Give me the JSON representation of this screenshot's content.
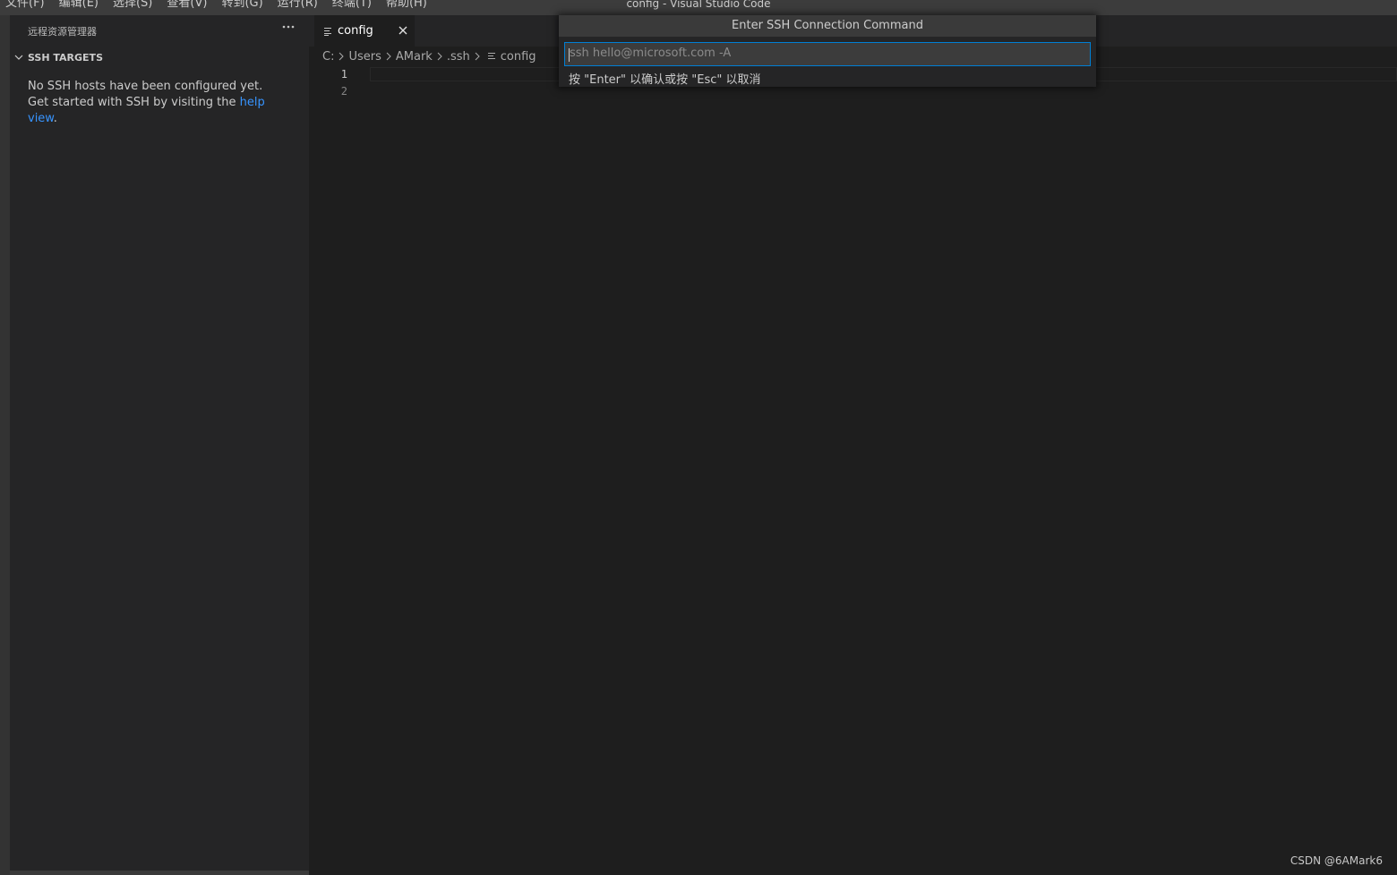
{
  "window": {
    "title": "config - Visual Studio Code"
  },
  "menu": [
    "文件(F)",
    "编辑(E)",
    "选择(S)",
    "查看(V)",
    "转到(G)",
    "运行(R)",
    "终端(T)",
    "帮助(H)"
  ],
  "sidebar": {
    "title": "远程资源管理器",
    "more_icon": "ellipsis-icon",
    "section": {
      "label": "SSH TARGETS",
      "icon": "chevron-down-icon"
    },
    "empty_message": {
      "text_before": "No SSH hosts have been configured yet. Get started with SSH by visiting the ",
      "link": "help view",
      "text_after": "."
    }
  },
  "editor": {
    "tab": {
      "label": "config",
      "icon": "file-lines-icon",
      "close_icon": "close-icon"
    },
    "breadcrumb": [
      "C:",
      "Users",
      "AMark",
      ".ssh",
      "config"
    ],
    "line_numbers": [
      "1",
      "2"
    ]
  },
  "quick_input": {
    "title": "Enter SSH Connection Command",
    "placeholder": "ssh hello@microsoft.com -A",
    "value": "",
    "message": "按 \"Enter\" 以确认或按 \"Esc\" 以取消"
  },
  "watermark": "CSDN @6AMark6",
  "colors": {
    "accent": "#007fd4",
    "link": "#3794ff",
    "background": "#1e1e1e",
    "sidebar": "#252526"
  }
}
